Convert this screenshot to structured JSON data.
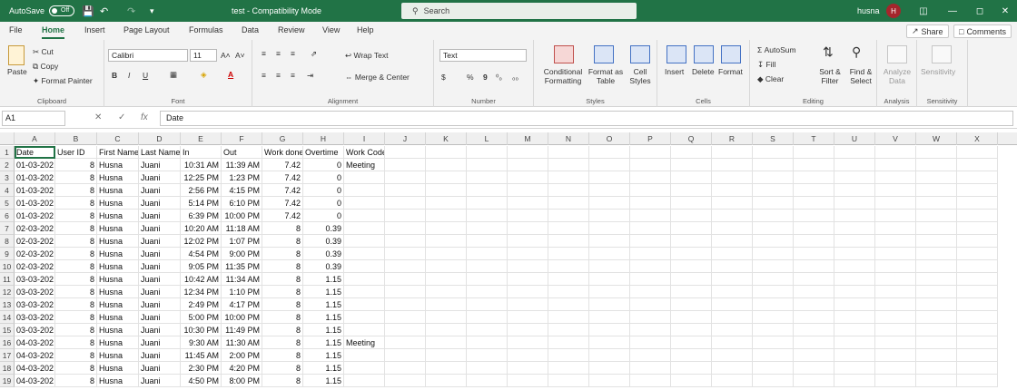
{
  "title_bar": {
    "autosave_label": "AutoSave",
    "toggle_state": "Off",
    "doc_title": "test - Compatibility Mode",
    "search_placeholder": "Search",
    "user_name": "husna",
    "user_initial": "H"
  },
  "menu": {
    "tabs": [
      "File",
      "Home",
      "Insert",
      "Page Layout",
      "Formulas",
      "Data",
      "Review",
      "View",
      "Help"
    ],
    "active": "Home",
    "share_label": "Share",
    "comments_label": "Comments"
  },
  "ribbon": {
    "clipboard": {
      "paste": "Paste",
      "cut": "Cut",
      "copy": "Copy",
      "format_painter": "Format Painter",
      "label": "Clipboard"
    },
    "font": {
      "name": "Calibri",
      "size": "11",
      "bold": "B",
      "italic": "I",
      "underline": "U",
      "grow": "A˄",
      "shrink": "A˅",
      "label": "Font"
    },
    "alignment": {
      "wrap": "Wrap Text",
      "merge": "Merge & Center",
      "label": "Alignment"
    },
    "number": {
      "format": "Text",
      "currency": "$",
      "percent": "%",
      "comma": "9",
      "inc": "⁰₀",
      "dec": "₀₀",
      "label": "Number"
    },
    "styles": {
      "conditional": "Conditional Formatting",
      "format_table": "Format as Table",
      "cell_styles": "Cell Styles",
      "label": "Styles"
    },
    "cells": {
      "insert": "Insert",
      "delete": "Delete",
      "format": "Format",
      "label": "Cells"
    },
    "editing": {
      "autosum": "AutoSum",
      "fill": "Fill",
      "clear": "Clear",
      "sort": "Sort & Filter",
      "find": "Find & Select",
      "label": "Editing"
    },
    "analysis": {
      "analyze": "Analyze Data",
      "label": "Analysis"
    },
    "sensitivity": {
      "sensitivity": "Sensitivity",
      "label": "Sensitivity"
    }
  },
  "formula_bar": {
    "name_box": "A1",
    "fx": "fx",
    "content": "Date"
  },
  "columns": [
    "A",
    "B",
    "C",
    "D",
    "E",
    "F",
    "G",
    "H",
    "I",
    "J",
    "K",
    "L",
    "M",
    "N",
    "O",
    "P",
    "Q",
    "R",
    "S",
    "T",
    "U",
    "V",
    "W",
    "X"
  ],
  "headers": [
    "Date",
    "User ID",
    "First Name",
    "Last Name",
    "In",
    "Out",
    "Work done",
    "Overtime",
    "Work Code"
  ],
  "rows": [
    [
      "01-03-202",
      "8",
      "Husna",
      "Juani",
      "10:31 AM",
      "11:39 AM",
      "7.42",
      "0",
      "Meeting"
    ],
    [
      "01-03-202",
      "8",
      "Husna",
      "Juani",
      "12:25 PM",
      "1:23 PM",
      "7.42",
      "0",
      ""
    ],
    [
      "01-03-202",
      "8",
      "Husna",
      "Juani",
      "2:56 PM",
      "4:15 PM",
      "7.42",
      "0",
      ""
    ],
    [
      "01-03-202",
      "8",
      "Husna",
      "Juani",
      "5:14 PM",
      "6:10 PM",
      "7.42",
      "0",
      ""
    ],
    [
      "01-03-202",
      "8",
      "Husna",
      "Juani",
      "6:39 PM",
      "10:00 PM",
      "7.42",
      "0",
      ""
    ],
    [
      "02-03-202",
      "8",
      "Husna",
      "Juani",
      "10:20 AM",
      "11:18 AM",
      "8",
      "0.39",
      ""
    ],
    [
      "02-03-202",
      "8",
      "Husna",
      "Juani",
      "12:02 PM",
      "1:07 PM",
      "8",
      "0.39",
      ""
    ],
    [
      "02-03-202",
      "8",
      "Husna",
      "Juani",
      "4:54 PM",
      "9:00 PM",
      "8",
      "0.39",
      ""
    ],
    [
      "02-03-202",
      "8",
      "Husna",
      "Juani",
      "9:05 PM",
      "11:35 PM",
      "8",
      "0.39",
      ""
    ],
    [
      "03-03-202",
      "8",
      "Husna",
      "Juani",
      "10:42 AM",
      "11:34 AM",
      "8",
      "1.15",
      ""
    ],
    [
      "03-03-202",
      "8",
      "Husna",
      "Juani",
      "12:34 PM",
      "1:10 PM",
      "8",
      "1.15",
      ""
    ],
    [
      "03-03-202",
      "8",
      "Husna",
      "Juani",
      "2:49 PM",
      "4:17 PM",
      "8",
      "1.15",
      ""
    ],
    [
      "03-03-202",
      "8",
      "Husna",
      "Juani",
      "5:00 PM",
      "10:00 PM",
      "8",
      "1.15",
      ""
    ],
    [
      "03-03-202",
      "8",
      "Husna",
      "Juani",
      "10:30 PM",
      "11:49 PM",
      "8",
      "1.15",
      ""
    ],
    [
      "04-03-202",
      "8",
      "Husna",
      "Juani",
      "9:30 AM",
      "11:30 AM",
      "8",
      "1.15",
      "Meeting"
    ],
    [
      "04-03-202",
      "8",
      "Husna",
      "Juani",
      "11:45 AM",
      "2:00 PM",
      "8",
      "1.15",
      ""
    ],
    [
      "04-03-202",
      "8",
      "Husna",
      "Juani",
      "2:30 PM",
      "4:20 PM",
      "8",
      "1.15",
      ""
    ],
    [
      "04-03-202",
      "8",
      "Husna",
      "Juani",
      "4:50 PM",
      "8:00 PM",
      "8",
      "1.15",
      ""
    ]
  ]
}
